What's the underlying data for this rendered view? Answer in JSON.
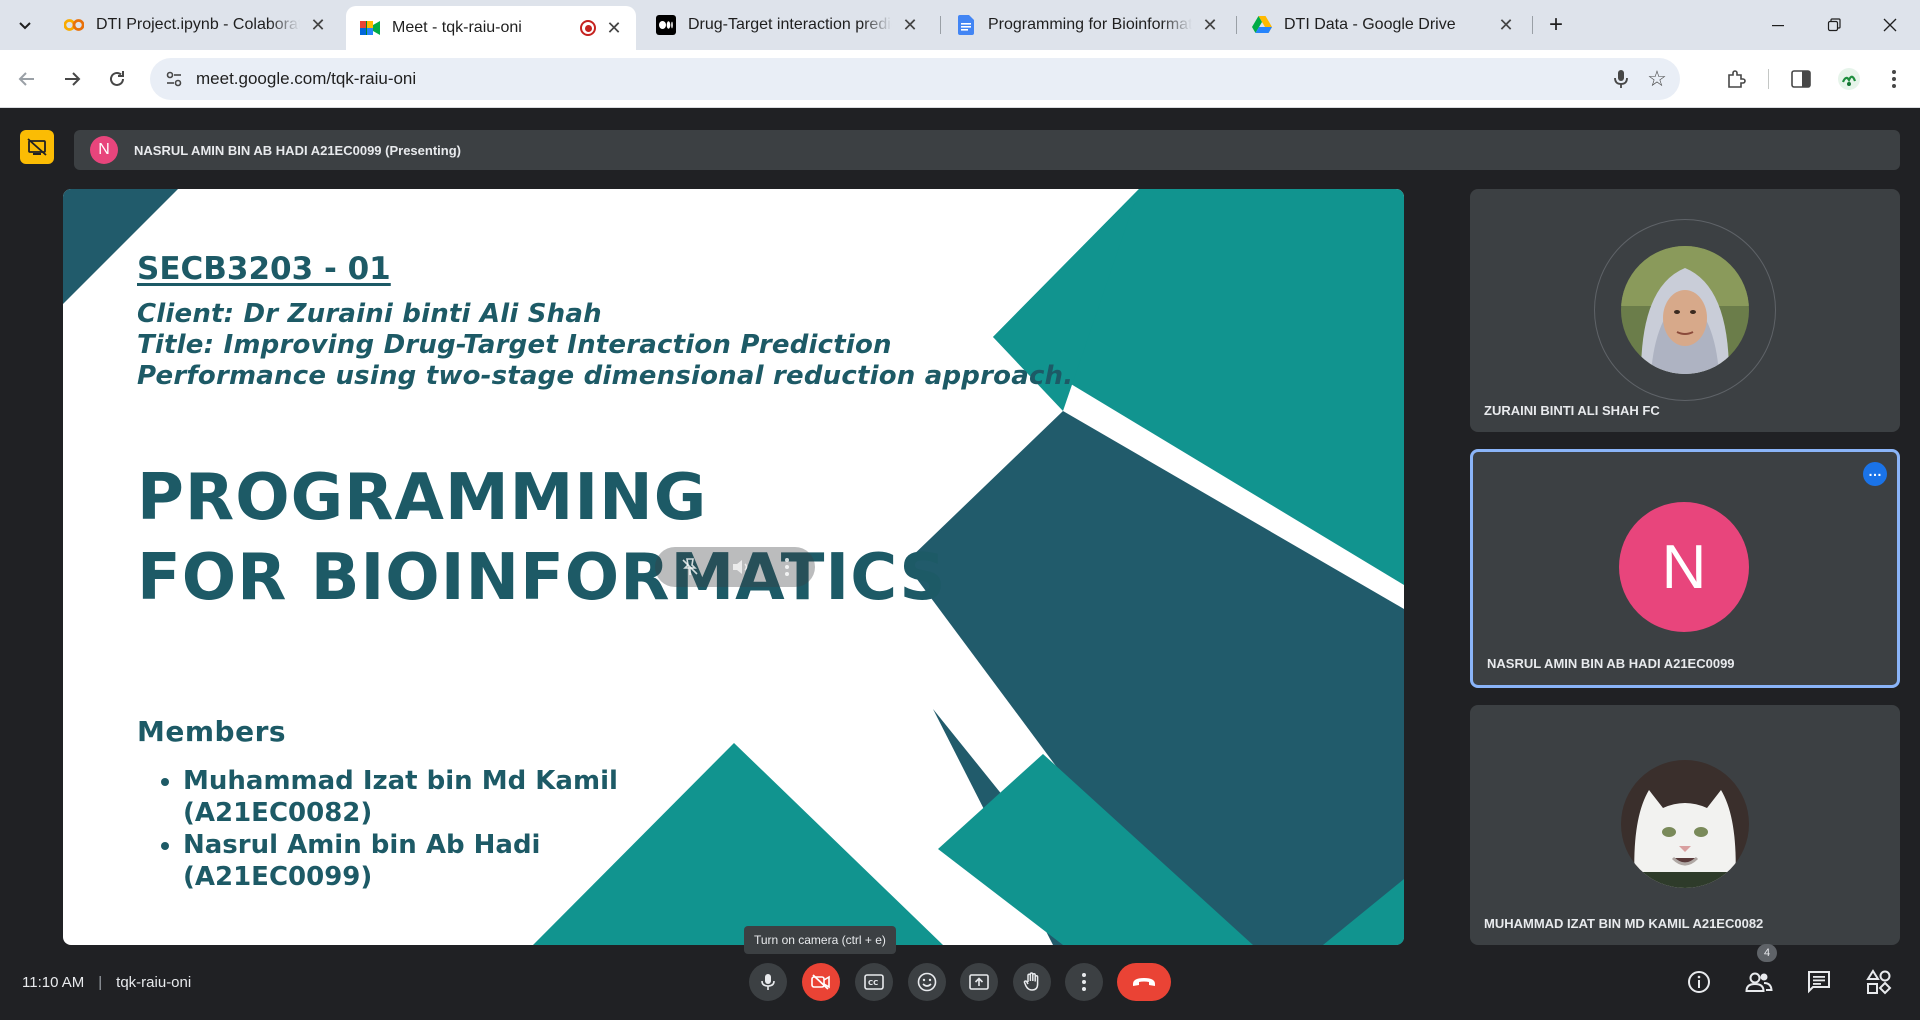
{
  "browser": {
    "tabs": [
      {
        "title": "DTI Project.ipynb - Colaboratory",
        "icon": "colab-icon"
      },
      {
        "title": "Meet - tqk-raiu-oni",
        "icon": "meet-icon",
        "active": true
      },
      {
        "title": "Drug-Target interaction prediction",
        "icon": "medium-icon"
      },
      {
        "title": "Programming for Bioinformatics",
        "icon": "docs-icon"
      },
      {
        "title": "DTI Data - Google Drive",
        "icon": "drive-icon"
      }
    ],
    "url": "meet.google.com/tqk-raiu-oni"
  },
  "meet": {
    "presenter_initial": "N",
    "presenter_label": "NASRUL AMIN BIN AB HADI A21EC0099 (Presenting)",
    "slide": {
      "code": "SECB3203 - 01",
      "client": "Client: Dr Zuraini binti Ali Shah",
      "title_line1": "Title: Improving Drug-Target Interaction Prediction",
      "title_line2": "Performance using two-stage dimensional reduction approach.",
      "big_line1": "PROGRAMMING",
      "big_line2": "FOR BIOINFORMATICS",
      "members_heading": "Members",
      "members": [
        {
          "name": "Muhammad Izat bin Md Kamil",
          "id": "(A21EC0082)"
        },
        {
          "name": "Nasrul Amin bin Ab Hadi",
          "id": "(A21EC0099)"
        }
      ]
    },
    "participants": [
      {
        "name": "ZURAINI BINTI ALI SHAH FC"
      },
      {
        "name": "NASRUL AMIN BIN AB HADI A21EC0099",
        "initial": "N"
      },
      {
        "name": "MUHAMMAD IZAT BIN MD KAMIL A21EC0082"
      }
    ],
    "time": "11:10 AM",
    "meeting_code": "tqk-raiu-oni",
    "tooltip": "Turn on camera (ctrl + e)",
    "people_count": "4"
  },
  "colors": {
    "slide_teal": "#11948f",
    "slide_dark": "#215b6b",
    "avatar_pink": "#e8457c",
    "end_call": "#ea4335"
  }
}
